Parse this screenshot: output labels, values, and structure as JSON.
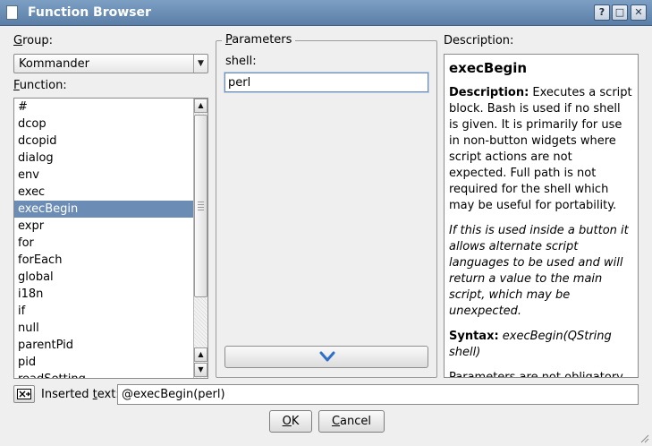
{
  "window": {
    "title": "Function Browser",
    "controls": {
      "help": "?",
      "maximize": "□",
      "close": "✕"
    }
  },
  "group": {
    "label_key": "G",
    "label_rest": "roup:",
    "selected": "Kommander"
  },
  "function": {
    "label_key": "F",
    "label_rest": "unction:",
    "items": [
      "#",
      "dcop",
      "dcopid",
      "dialog",
      "env",
      "exec",
      "execBegin",
      "expr",
      "for",
      "forEach",
      "global",
      "i18n",
      "if",
      "null",
      "parentPid",
      "pid",
      "readSetting"
    ],
    "selected_index": 6
  },
  "parameters": {
    "title_key": "P",
    "title_rest": "arameters",
    "shell_label": "shell:",
    "shell_value": "perl"
  },
  "description": {
    "label": "Description:",
    "heading": "execBegin",
    "desc_label": "Description:",
    "desc_text": " Executes a script block. Bash is used if no shell is given. It is primarily for use in non-button widgets where script actions are not expected. Full path is not required for the shell which may be useful for portability.",
    "italic_text": "If this is used inside a button it allows alternate script languages to be used and will return a value to the main script, which may be unexpected.",
    "syntax_label": "Syntax:",
    "syntax_value": " execBegin(QString shell)",
    "params_note": "Parameters are not obligatory."
  },
  "inserted": {
    "label_pre": "Inserted ",
    "label_key": "t",
    "label_post": "ext:",
    "value": "@execBegin(perl)"
  },
  "buttons": {
    "ok_key": "O",
    "ok_rest": "K",
    "cancel_key": "C",
    "cancel_rest": "ancel"
  },
  "colors": {
    "selection": "#6b8cb4",
    "titlebar": "#6a8db5"
  }
}
